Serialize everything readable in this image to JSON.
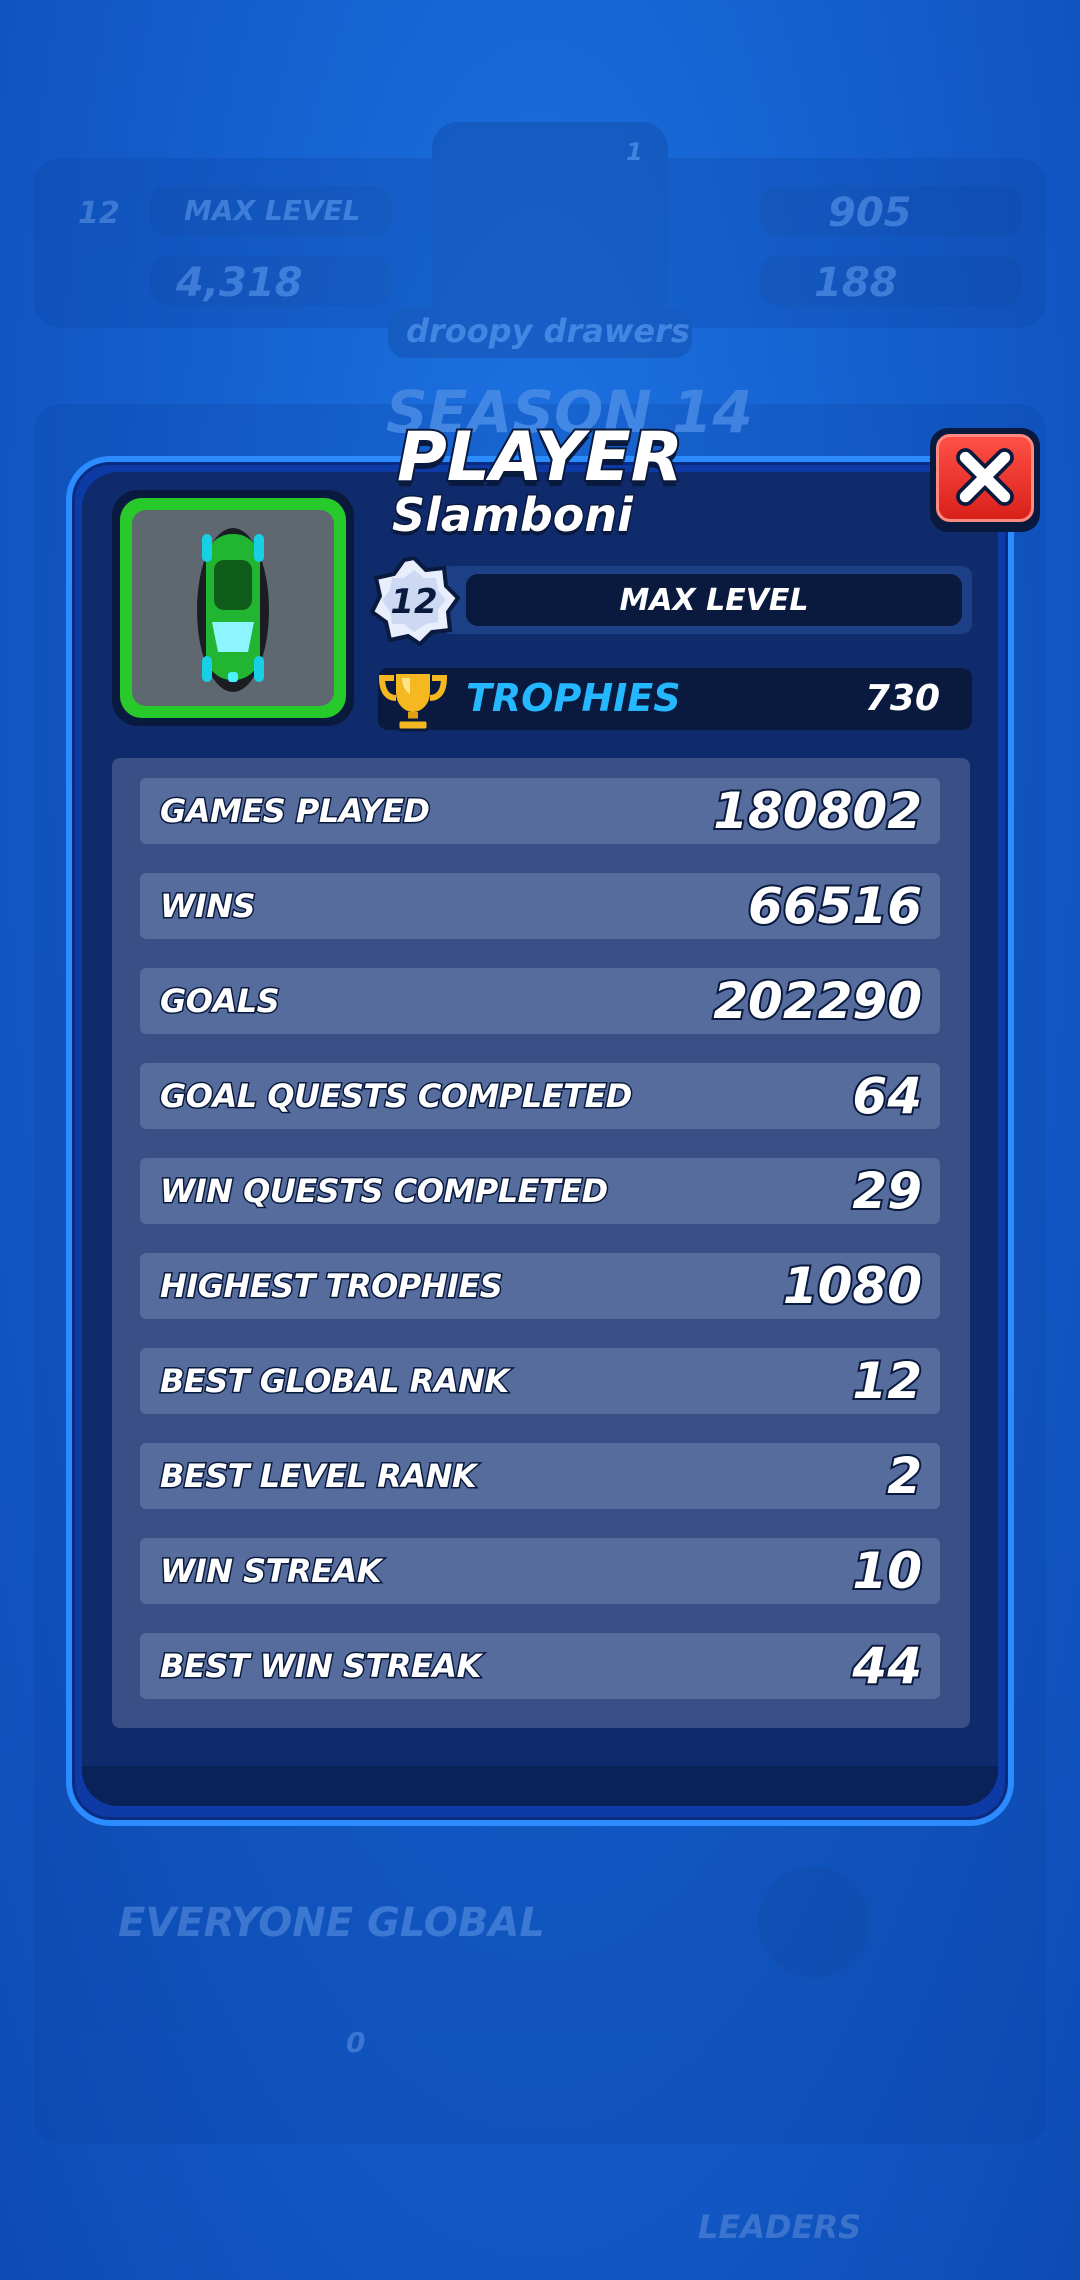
{
  "background": {
    "level_label": "MAX LEVEL",
    "level_num": "12",
    "coins": "4,318",
    "trophies": "905",
    "gems": "188",
    "rank_badge": "1",
    "username": "droopy drawers",
    "season": "SEASON 14",
    "leaderboard_label": "EVERYONE GLOBAL",
    "notif_count": "0",
    "leaders_tab": "LEADERS"
  },
  "modal": {
    "title": "PLAYER",
    "player_name": "Slamboni",
    "level": "12",
    "level_label": "MAX LEVEL",
    "trophies_label": "TROPHIES",
    "trophies_value": "730"
  },
  "stats": [
    {
      "label": "GAMES PLAYED",
      "value": "180802"
    },
    {
      "label": "WINS",
      "value": "66516"
    },
    {
      "label": "GOALS",
      "value": "202290"
    },
    {
      "label": "GOAL QUESTS COMPLETED",
      "value": "64"
    },
    {
      "label": "WIN QUESTS COMPLETED",
      "value": "29"
    },
    {
      "label": "HIGHEST TROPHIES",
      "value": "1080"
    },
    {
      "label": "BEST GLOBAL RANK",
      "value": "12"
    },
    {
      "label": "BEST LEVEL RANK",
      "value": "2"
    },
    {
      "label": "WIN STREAK",
      "value": "10"
    },
    {
      "label": "BEST WIN STREAK",
      "value": "44"
    }
  ],
  "colors": {
    "accent_blue": "#25b7ff",
    "close_red": "#e8342b",
    "avatar_green": "#28c92b"
  }
}
